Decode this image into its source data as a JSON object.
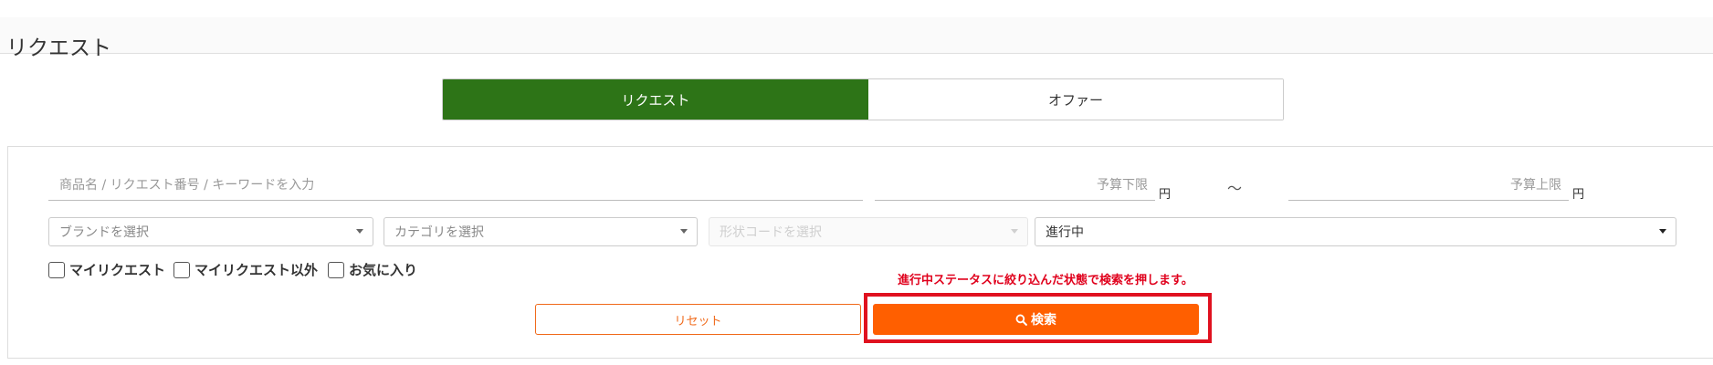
{
  "page": {
    "title": "リクエスト"
  },
  "tabs": [
    {
      "label": "リクエスト",
      "active": true
    },
    {
      "label": "オファー",
      "active": false
    }
  ],
  "filters": {
    "keyword_placeholder": "商品名 / リクエスト番号 / キーワードを入力",
    "budget_min_placeholder": "予算下限",
    "budget_max_placeholder": "予算上限",
    "currency": "円",
    "range_separator": "〜",
    "brand_select": "ブランドを選択",
    "category_select": "カテゴリを選択",
    "shape_code_select": "形状コードを選択",
    "status_select": "進行中"
  },
  "checkboxes": [
    {
      "label": "マイリクエスト",
      "checked": false
    },
    {
      "label": "マイリクエスト以外",
      "checked": false
    },
    {
      "label": "お気に入り",
      "checked": false
    }
  ],
  "notice": "進行中ステータスに絞り込んだ状態で検索を押します。",
  "buttons": {
    "reset": "リセット",
    "search": "検索",
    "search_icon": "search-icon"
  },
  "colors": {
    "active_tab": "#2d7417",
    "accent_orange": "#ff5f00",
    "highlight_red": "#e0111f"
  }
}
